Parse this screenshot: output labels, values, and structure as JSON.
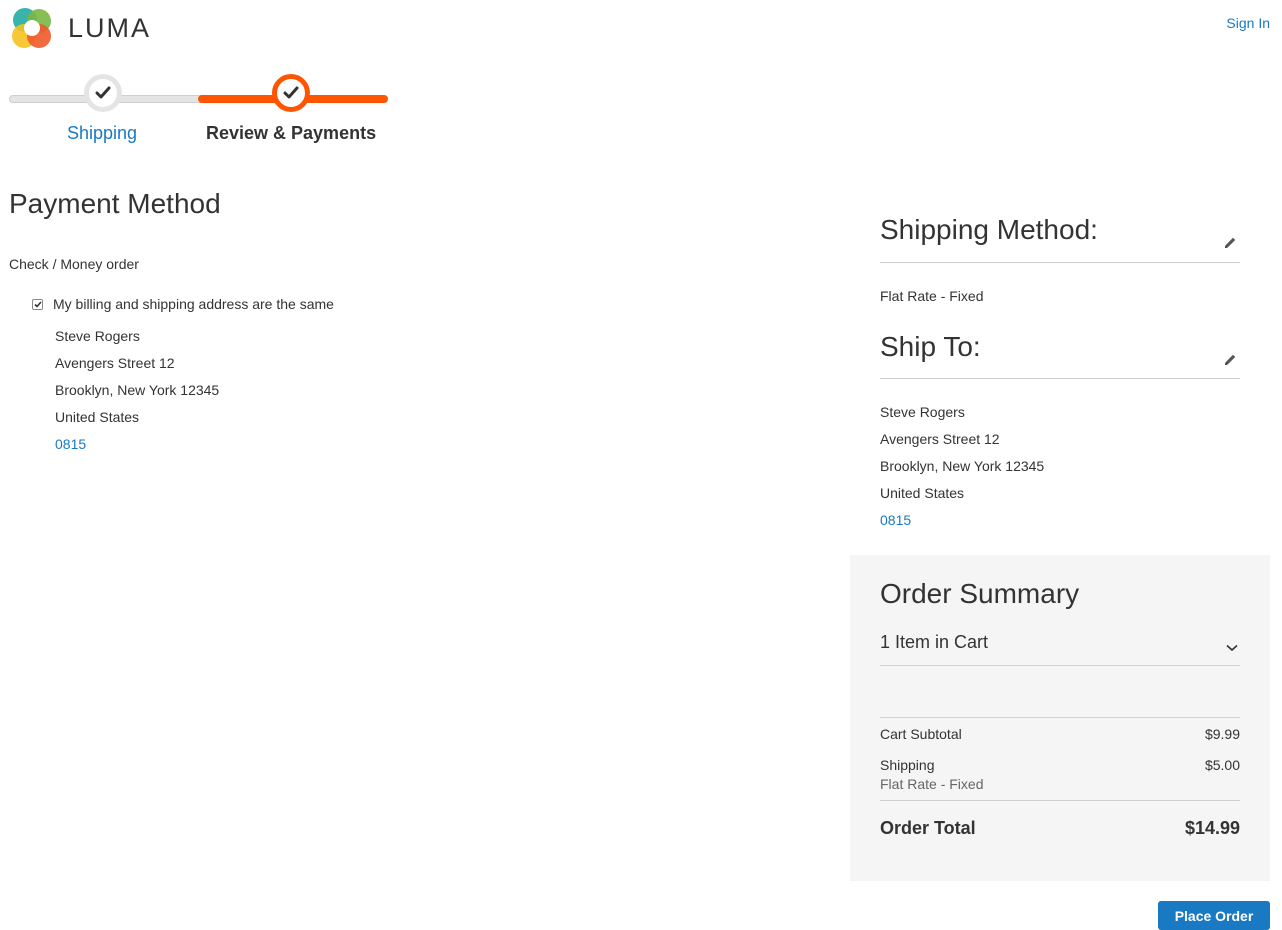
{
  "header": {
    "logo_text": "LUMA",
    "sign_in": "Sign In"
  },
  "progress": {
    "steps": [
      {
        "label": "Shipping",
        "state": "complete"
      },
      {
        "label": "Review & Payments",
        "state": "active"
      }
    ]
  },
  "payment": {
    "title": "Payment Method",
    "method": "Check / Money order",
    "same_address_label": "My billing and shipping address are the same",
    "same_address_checked": true,
    "address": {
      "name": "Steve Rogers",
      "street": "Avengers Street 12",
      "city_line": "Brooklyn, New York 12345",
      "country": "United States",
      "phone": "0815"
    }
  },
  "shipping_method": {
    "title": "Shipping Method:",
    "value": "Flat Rate - Fixed"
  },
  "ship_to": {
    "title": "Ship To:",
    "name": "Steve Rogers",
    "street": "Avengers Street 12",
    "city_line": "Brooklyn, New York 12345",
    "country": "United States",
    "phone": "0815"
  },
  "summary": {
    "title": "Order Summary",
    "items_label": "1 Item in Cart",
    "subtotal_label": "Cart Subtotal",
    "subtotal_value": "$9.99",
    "shipping_label": "Shipping",
    "shipping_sub": "Flat Rate - Fixed",
    "shipping_value": "$5.00",
    "total_label": "Order Total",
    "total_value": "$14.99"
  },
  "actions": {
    "place_order": "Place Order"
  },
  "colors": {
    "accent_orange": "#ff5501",
    "link_blue": "#1979c3",
    "summary_bg": "#f5f5f5"
  },
  "icons": [
    "luma-logo-icon",
    "checkmark-icon",
    "pencil-icon",
    "chevron-down-icon"
  ]
}
